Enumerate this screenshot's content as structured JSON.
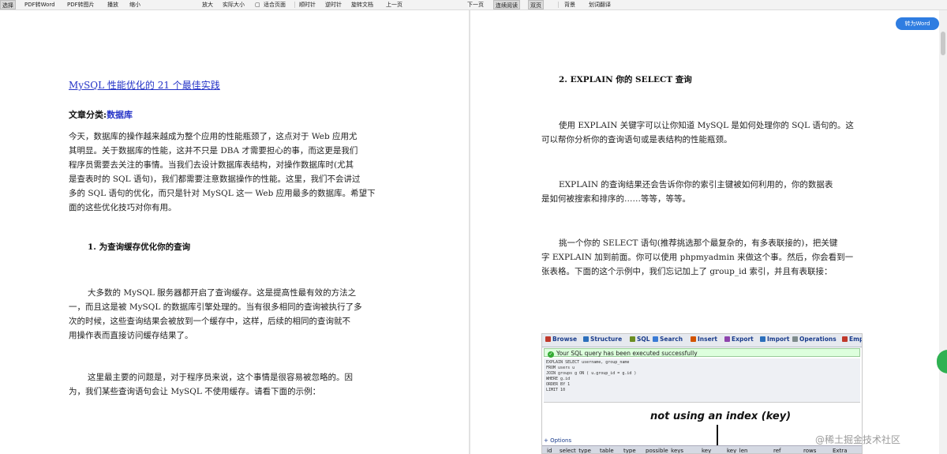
{
  "toolbar": {
    "items": [
      "选择",
      "PDF转Word",
      "PDF转图片",
      "播放",
      "缩小",
      "放大",
      "实际大小",
      "适合页面",
      "顺时针",
      "逆时针",
      "旋转文档",
      "上一页",
      "下一页",
      "连续阅读",
      "双页",
      "背景",
      "划词翻译"
    ]
  },
  "convert_button": "转为Word",
  "left_page": {
    "title": "MySQL 性能优化的 21 个最佳实践",
    "category_label": "文章分类:",
    "category_value": "数据库",
    "intro_lines": [
      "今天，数据库的操作越来越成为整个应用的性能瓶颈了，这点对于 Web 应用尤",
      "其明显。关于数据库的性能，这并不只是 DBA 才需要担心的事，而这更是我们",
      "程序员需要去关注的事情。当我们去设计数据库表结构，对操作数据库时(尤其",
      "是查表时的 SQL 语句)，我们都需要注意数据操作的性能。这里，我们不会讲过",
      "多的 SQL 语句的优化，而只是针对 MySQL 这一 Web 应用最多的数据库。希望下",
      "面的这些优化技巧对你有用。"
    ],
    "heading1": "1.  为查询缓存优化你的查询",
    "p1_lines": [
      "大多数的 MySQL 服务器都开启了查询缓存。这是提高性最有效的方法之",
      "一，而且这是被 MySQL 的数据库引擎处理的。当有很多相同的查询被执行了多",
      "次的时候，这些查询结果会被放到一个缓存中，这样，后续的相同的查询就不",
      "用操作表而直接访问缓存结果了。"
    ],
    "p2_lines": [
      "这里最主要的问题是，对于程序员来说，这个事情是很容易被忽略的。因",
      "为，我们某些查询语句会让 MySQL 不使用缓存。请看下面的示例："
    ]
  },
  "right_page": {
    "heading2": "2.  EXPLAIN 你的 SELECT 查询",
    "p1_lines": [
      "使用 EXPLAIN 关键字可以让你知道 MySQL 是如何处理你的 SQL 语句的。这",
      "可以帮你分析你的查询语句或是表结构的性能瓶颈。"
    ],
    "p2_lines": [
      "EXPLAIN 的查询结果还会告诉你你的索引主键被如何利用的，你的数据表",
      "是如何被搜索和排序的……等等，等等。"
    ],
    "p3_lines": [
      "挑一个你的 SELECT 语句(推荐挑选那个最复杂的，有多表联接的)，把关键",
      "字 EXPLAIN 加到前面。你可以使用 phpmyadmin 来做这个事。然后，你会看到一",
      "张表格。下面的这个示例中，我们忘记加上了 group_id 索引，并且有表联接："
    ]
  },
  "screenshot": {
    "tabs": [
      "Browse",
      "Structure",
      "SQL",
      "Search",
      "Insert",
      "Export",
      "Import",
      "Operations",
      "Emp"
    ],
    "tab_colors": [
      "#c0392b",
      "#2c6fbb",
      "#6b8e23",
      "#3a7bd5",
      "#d35400",
      "#8e44ad",
      "#2c6fbb",
      "#7f8c8d",
      "#c0392b"
    ],
    "success_msg": "Your SQL query has been executed successfully",
    "sql_lines": [
      "EXPLAIN SELECT username, group_name",
      "FROM users u",
      "JOIN groups g ON ( u.group_id = g.id )",
      "WHERE g.id",
      "ORDER BY 1",
      "LIMIT 10"
    ],
    "annotation": "not using an index (key)",
    "options_label": "+ Options",
    "columns": [
      "id",
      "select_type",
      "table",
      "type",
      "possible_keys",
      "key",
      "key_len",
      "ref",
      "rows",
      "Extra"
    ]
  },
  "watermark": "@稀土掘金技术社区"
}
